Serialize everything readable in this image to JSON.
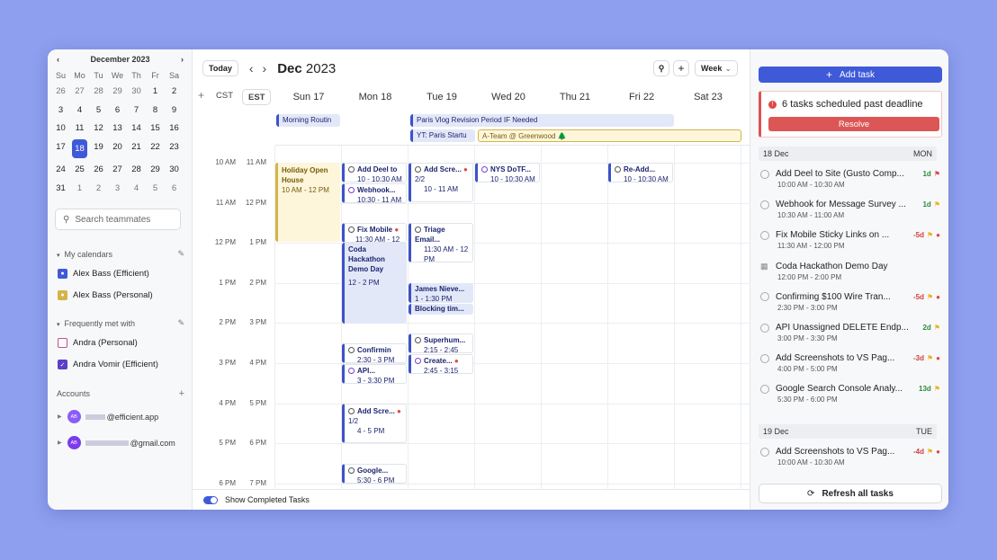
{
  "mini_calendar": {
    "title": "December 2023",
    "weekdays": [
      "Su",
      "Mo",
      "Tu",
      "We",
      "Th",
      "Fr",
      "Sa"
    ],
    "days": [
      [
        "26",
        "27",
        "28",
        "29",
        "30",
        "1",
        "2"
      ],
      [
        "3",
        "4",
        "5",
        "6",
        "7",
        "8",
        "9"
      ],
      [
        "10",
        "11",
        "12",
        "13",
        "14",
        "15",
        "16"
      ],
      [
        "17",
        "18",
        "19",
        "20",
        "21",
        "22",
        "23"
      ],
      [
        "24",
        "25",
        "26",
        "27",
        "28",
        "29",
        "30"
      ],
      [
        "31",
        "1",
        "2",
        "3",
        "4",
        "5",
        "6"
      ]
    ],
    "selected": "18"
  },
  "sidebar": {
    "search_placeholder": "Search teammates",
    "my_calendars_title": "My calendars",
    "my_calendars": [
      {
        "label": "Alex Bass (Efficient)",
        "color": "#3f5ad8"
      },
      {
        "label": "Alex Bass (Personal)",
        "color": "#d4b44a"
      }
    ],
    "frequent_title": "Frequently met with",
    "frequent": [
      {
        "label": "Andra (Personal)",
        "checked": false
      },
      {
        "label": "Andra Vomir (Efficient)",
        "checked": true
      }
    ],
    "accounts_title": "Accounts",
    "accounts": [
      {
        "avatar": "AB",
        "label": "@efficient.app"
      },
      {
        "avatar": "AB",
        "label": "@gmail.com"
      }
    ]
  },
  "toolbar": {
    "today": "Today",
    "month": "Dec",
    "year": "2023",
    "view": "Week"
  },
  "timezones": [
    "CST",
    "EST"
  ],
  "days": [
    "Sun 17",
    "Mon 18",
    "Tue 19",
    "Wed 20",
    "Thu 21",
    "Fri 22",
    "Sat 23"
  ],
  "times_cst": [
    "10 AM",
    "11 AM",
    "12 PM",
    "1 PM",
    "2 PM",
    "3 PM",
    "4 PM",
    "5 PM",
    "6 PM"
  ],
  "times_est": [
    "11 AM",
    "12 PM",
    "1 PM",
    "2 PM",
    "3 PM",
    "4 PM",
    "5 PM",
    "6 PM",
    "7 PM"
  ],
  "allday": {
    "morning": "Morning Routin",
    "paris": "Paris Vlog Revision Period IF Needed",
    "yt": "YT: Paris Startu",
    "ateam": "A-Team @ Greenwood 🌲"
  },
  "events": {
    "holiday": {
      "title": "Holiday Open House",
      "time": "10 AM - 12 PM"
    },
    "deel": {
      "title": "Add Deel to",
      "time": "10 - 10:30 AM"
    },
    "webhook": {
      "title": "Webhook...",
      "time": "10:30 - 11 AM"
    },
    "fixmobile": {
      "title": "Fix Mobile",
      "time": "11:30 AM - 12 PM"
    },
    "coda": {
      "title": "Coda Hackathon Demo Day",
      "time": "12 - 2 PM"
    },
    "confirming": {
      "title": "Confirmin",
      "time": "2:30 - 3 PM"
    },
    "api": {
      "title": "API...",
      "time": "3 - 3:30 PM"
    },
    "addscre2": {
      "title": "Add Scre...",
      "time": "4 - 5 PM",
      "count": "1/2"
    },
    "google": {
      "title": "Google...",
      "time": "5:30 - 6 PM"
    },
    "addscre1": {
      "title": "Add Scre...",
      "time": "10 - 11 AM",
      "count": "2/2"
    },
    "triage": {
      "title": "Triage Email...",
      "time": "11:30 AM - 12 PM"
    },
    "james": {
      "title": "James Nieve...",
      "time": "1 - 1:30 PM"
    },
    "blocking": {
      "title": "Blocking tim..."
    },
    "superhum": {
      "title": "Superhum...",
      "time": "2:15 - 2:45 PM"
    },
    "create": {
      "title": "Create...",
      "time": "2:45 - 3:15 PM"
    },
    "nys": {
      "title": "NYS DoTF...",
      "time": "10 - 10:30 AM"
    },
    "readd": {
      "title": "Re-Add...",
      "time": "10 - 10:30 AM"
    }
  },
  "bottom": {
    "show_completed": "Show Completed Tasks"
  },
  "right": {
    "add_task": "Add task",
    "warning": "6 tasks scheduled past deadline",
    "resolve": "Resolve",
    "day1": {
      "date": "18 Dec",
      "dow": "MON"
    },
    "day2": {
      "date": "19 Dec",
      "dow": "TUE"
    },
    "tasks": [
      {
        "name": "Add Deel to Site (Gusto Comp...",
        "due": "1d",
        "dueColor": "#2f8a3a",
        "flag": "#e04848",
        "time": "10:00 AM - 10:30 AM"
      },
      {
        "name": "Webhook for Message Survey ...",
        "due": "1d",
        "dueColor": "#2f8a3a",
        "flag": "#e8b420",
        "time": "10:30 AM - 11:00 AM"
      },
      {
        "name": "Fix Mobile Sticky Links on ...",
        "due": "-5d",
        "dueColor": "#d04040",
        "flag": "#e8b420",
        "alert": true,
        "time": "11:30 AM - 12:00 PM"
      },
      {
        "name": "Coda Hackathon Demo Day",
        "calendar": true,
        "time": "12:00 PM - 2:00 PM"
      },
      {
        "name": "Confirming $100 Wire Tran...",
        "due": "-5d",
        "dueColor": "#d04040",
        "flag": "#e8b420",
        "alert": true,
        "time": "2:30 PM - 3:00 PM"
      },
      {
        "name": "API Unassigned DELETE Endp...",
        "due": "2d",
        "dueColor": "#2f8a3a",
        "flag": "#e8b420",
        "time": "3:00 PM - 3:30 PM"
      },
      {
        "name": "Add Screenshots to VS Pag...",
        "due": "-3d",
        "dueColor": "#d04040",
        "flag": "#e8b420",
        "alert": true,
        "time": "4:00 PM - 5:00 PM"
      },
      {
        "name": "Google Search Console Analy...",
        "due": "13d",
        "dueColor": "#2f8a3a",
        "flag": "#e8b420",
        "time": "5:30 PM - 6:00 PM"
      }
    ],
    "tasks2": [
      {
        "name": "Add Screenshots to VS Pag...",
        "due": "-4d",
        "dueColor": "#d04040",
        "flag": "#e8b420",
        "alert": true,
        "time": "10:00 AM - 10:30 AM"
      }
    ],
    "refresh": "Refresh all tasks"
  }
}
